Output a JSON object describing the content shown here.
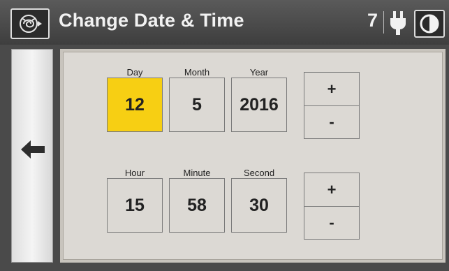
{
  "header": {
    "title": "Change Date & Time",
    "status_count": "7"
  },
  "icons": {
    "logo": "rose-logo-icon",
    "power": "plug-icon",
    "contrast": "contrast-icon",
    "back": "arrow-left-icon"
  },
  "colors": {
    "selected": "#f7cf13",
    "panel": "#dcd9d4",
    "header": "#4a4a4a"
  },
  "date": {
    "day_label": "Day",
    "month_label": "Month",
    "year_label": "Year",
    "day": "12",
    "month": "5",
    "year": "2016",
    "selected_field": "Day",
    "plus_label": "+",
    "minus_label": "-"
  },
  "time": {
    "hour_label": "Hour",
    "minute_label": "Minute",
    "second_label": "Second",
    "hour": "15",
    "minute": "58",
    "second": "30",
    "plus_label": "+",
    "minus_label": "-"
  }
}
